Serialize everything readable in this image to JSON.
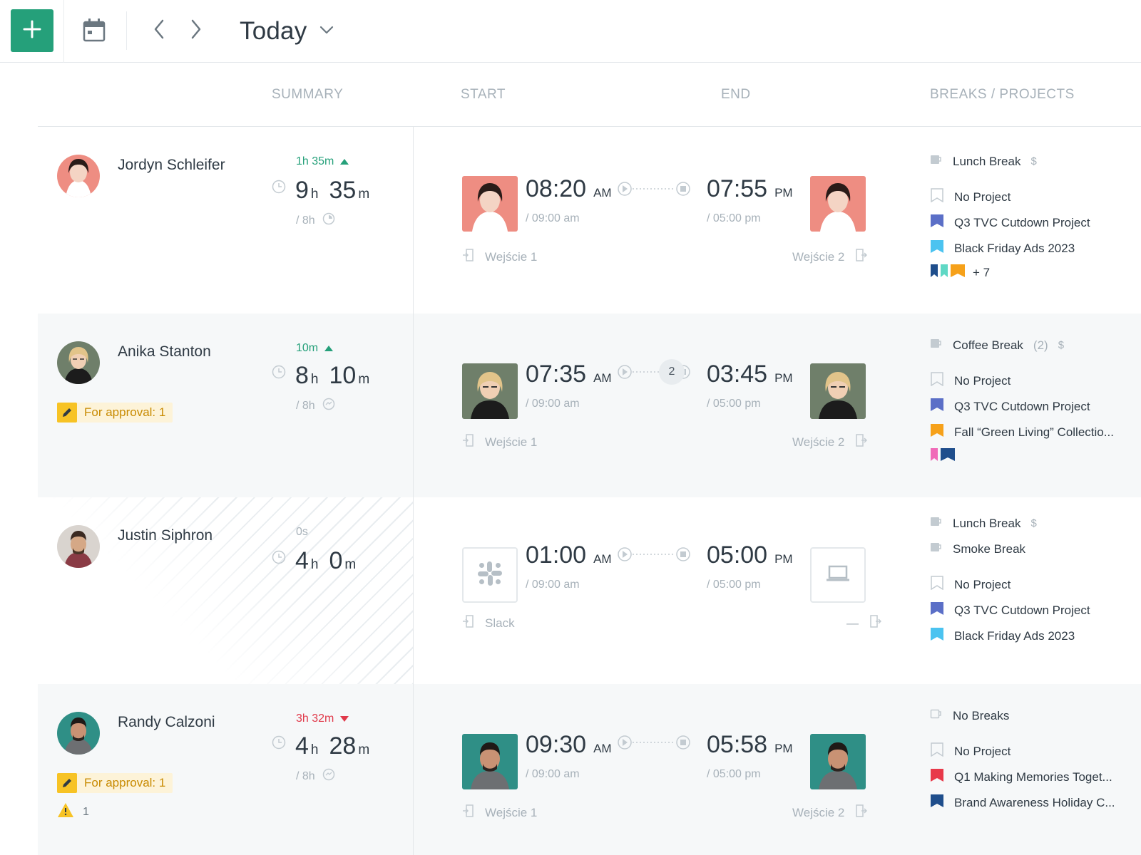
{
  "toolbar": {
    "add_icon": "plus-icon",
    "calendar_icon": "calendar-icon",
    "prev_icon": "chevron-left-icon",
    "next_icon": "chevron-right-icon",
    "period": "Today",
    "accent": "#25a07a"
  },
  "columns": {
    "summary": "SUMMARY",
    "start": "START",
    "end": "END",
    "breaks_projects": "BREAKS / PROJECTS"
  },
  "rows": [
    {
      "name": "Jordyn Schleifer",
      "diff": "1h 35m",
      "diff_dir": "up",
      "hours": "9",
      "h_unit": "h",
      "minutes": "35",
      "m_unit": "m",
      "target": "/ 8h",
      "start_time": "08:20",
      "start_ampm": "AM",
      "start_planned": "/ 09:00 am",
      "end_time": "07:55",
      "end_ampm": "PM",
      "end_planned": "/ 05:00 pm",
      "start_source": "Wejście 1",
      "end_source": "Wejście 2",
      "items": [
        {
          "label": "Lunch Break",
          "kind": "break",
          "dollar": "$"
        },
        {
          "label": "No Project",
          "kind": "none"
        },
        {
          "label": "Q3 TVC Cutdown Project",
          "kind": "project",
          "color": "#5b6fc7"
        },
        {
          "label": "Black Friday Ads 2023",
          "kind": "project",
          "color": "#4bc3f0"
        }
      ],
      "extra_colors": [
        "#1f4e8c",
        "#5fd8c5",
        "#f6a11a"
      ],
      "more": "+ 7"
    },
    {
      "name": "Anika Stanton",
      "diff": "10m",
      "diff_dir": "up",
      "hours": "8",
      "h_unit": "h",
      "minutes": "10",
      "m_unit": "m",
      "target": "/ 8h",
      "approval": "For approval: 1",
      "start_time": "07:35",
      "start_ampm": "AM",
      "start_planned": "/ 09:00 am",
      "end_time": "03:45",
      "end_ampm": "PM",
      "end_planned": "/ 05:00 pm",
      "breaks_count": "2",
      "start_source": "Wejście 1",
      "end_source": "Wejście 2",
      "items": [
        {
          "label": "Coffee Break",
          "kind": "break",
          "count": "(2)",
          "dollar": "$"
        },
        {
          "label": "No Project",
          "kind": "none"
        },
        {
          "label": "Q3 TVC Cutdown Project",
          "kind": "project",
          "color": "#5b6fc7"
        },
        {
          "label": "Fall “Green Living” Collectio...",
          "kind": "project",
          "color": "#f6a11a"
        }
      ],
      "extra_colors": [
        "#f06ab8",
        "#1f4e8c"
      ]
    },
    {
      "name": "Justin Siphron",
      "diff": "0s",
      "diff_dir": "zero",
      "hours": "4",
      "h_unit": "h",
      "minutes": "0",
      "m_unit": "m",
      "start_time": "01:00",
      "start_ampm": "AM",
      "start_planned": "/ 09:00 am",
      "end_time": "05:00",
      "end_ampm": "PM",
      "end_planned": "/ 05:00 pm",
      "start_source": "Slack",
      "end_source": "—",
      "start_device_icon": "slack-icon",
      "end_device_icon": "laptop-icon",
      "items": [
        {
          "label": "Lunch Break",
          "kind": "break",
          "dollar": "$"
        },
        {
          "label": "Smoke Break",
          "kind": "break"
        },
        {
          "label": "No Project",
          "kind": "none"
        },
        {
          "label": "Q3 TVC Cutdown Project",
          "kind": "project",
          "color": "#5b6fc7"
        },
        {
          "label": "Black Friday Ads 2023",
          "kind": "project",
          "color": "#4bc3f0"
        }
      ]
    },
    {
      "name": "Randy Calzoni",
      "diff": "3h 32m",
      "diff_dir": "down",
      "hours": "4",
      "h_unit": "h",
      "minutes": "28",
      "m_unit": "m",
      "target": "/ 8h",
      "approval": "For approval: 1",
      "warnings": "1",
      "start_time": "09:30",
      "start_ampm": "AM",
      "start_planned": "/ 09:00 am",
      "end_time": "05:58",
      "end_ampm": "PM",
      "end_planned": "/ 05:00 pm",
      "start_source": "Wejście 1",
      "end_source": "Wejście 2",
      "items": [
        {
          "label": "No Breaks",
          "kind": "nobreak"
        },
        {
          "label": "No Project",
          "kind": "none"
        },
        {
          "label": "Q1 Making Memories Toget...",
          "kind": "project",
          "color": "#e8394a"
        },
        {
          "label": "Brand Awareness Holiday C...",
          "kind": "project",
          "color": "#1f4e8c"
        }
      ]
    }
  ]
}
